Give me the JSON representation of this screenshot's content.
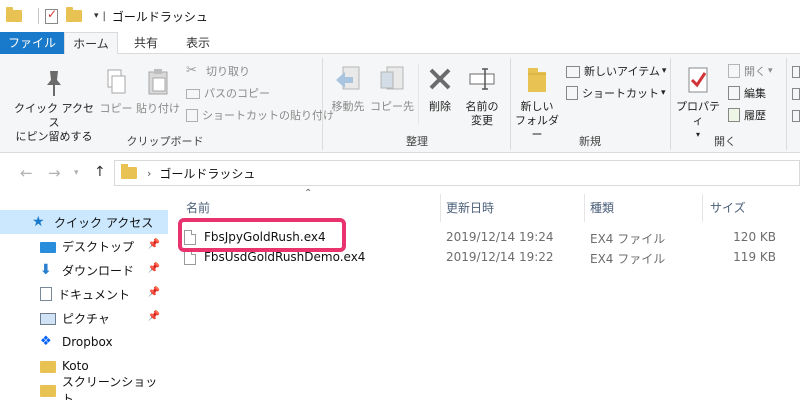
{
  "window": {
    "title": "ゴールドラッシュ"
  },
  "tabs": [
    {
      "label": "ファイル"
    },
    {
      "label": "ホーム"
    },
    {
      "label": "共有"
    },
    {
      "label": "表示"
    }
  ],
  "ribbon": {
    "clipboard": {
      "pin_label_1": "クイック アクセス",
      "pin_label_2": "にピン留めする",
      "copy_label": "コピー",
      "paste_label": "貼り付け",
      "cut_label": "切り取り",
      "copy_path_label": "パスのコピー",
      "paste_shortcut_label": "ショートカットの貼り付け",
      "group_label": "クリップボード"
    },
    "organize": {
      "move_label": "移動先",
      "copy_to_label": "コピー先",
      "delete_label": "削除",
      "rename_label_1": "名前の",
      "rename_label_2": "変更",
      "group_label": "整理"
    },
    "new": {
      "new_folder_label_1": "新しい",
      "new_folder_label_2": "フォルダー",
      "new_item_label": "新しいアイテム",
      "shortcut_label": "ショートカット",
      "group_label": "新規"
    },
    "open": {
      "properties_label": "プロパティ",
      "open_label": "開く",
      "edit_label": "編集",
      "history_label": "履歴",
      "group_label": "開く"
    }
  },
  "address": {
    "crumb": "ゴールドラッシュ"
  },
  "nav": {
    "items": [
      {
        "label": "クイック アクセス"
      },
      {
        "label": "デスクトップ"
      },
      {
        "label": "ダウンロード"
      },
      {
        "label": "ドキュメント"
      },
      {
        "label": "ピクチャ"
      },
      {
        "label": "Dropbox"
      },
      {
        "label": "Koto"
      },
      {
        "label": "スクリーンショット"
      }
    ]
  },
  "filelist": {
    "columns": {
      "name": "名前",
      "date": "更新日時",
      "type": "種類",
      "size": "サイズ"
    },
    "rows": [
      {
        "name": "FbsJpyGoldRush.ex4",
        "date": "2019/12/14 19:24",
        "type": "EX4 ファイル",
        "size": "120 KB"
      },
      {
        "name": "FbsUsdGoldRushDemo.ex4",
        "date": "2019/12/14 19:22",
        "type": "EX4 ファイル",
        "size": "119 KB"
      }
    ]
  },
  "colors": {
    "accent": "#1979ca",
    "highlight": "#e8336e",
    "selected": "#cce8ff",
    "folder": "#e8c253"
  }
}
